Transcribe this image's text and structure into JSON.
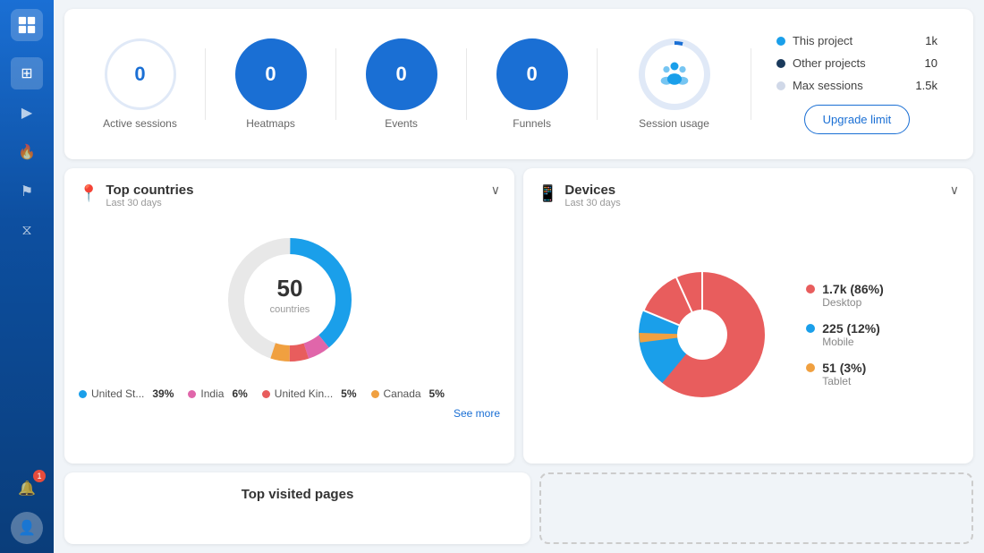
{
  "sidebar": {
    "icons": [
      {
        "name": "grid-icon",
        "symbol": "⊞",
        "active": true
      },
      {
        "name": "play-icon",
        "symbol": "▶"
      },
      {
        "name": "flame-icon",
        "symbol": "🔥"
      },
      {
        "name": "flag-icon",
        "symbol": "⚑"
      },
      {
        "name": "filter-icon",
        "symbol": "⧖"
      }
    ],
    "bottom_icons": [
      {
        "name": "bell-icon",
        "symbol": "🔔",
        "badge": "1"
      },
      {
        "name": "avatar-icon",
        "symbol": "👤"
      }
    ]
  },
  "stats": {
    "items": [
      {
        "label": "Active sessions",
        "value": "0",
        "filled": false
      },
      {
        "label": "Heatmaps",
        "value": "0",
        "filled": true
      },
      {
        "label": "Events",
        "value": "0",
        "filled": true
      },
      {
        "label": "Funnels",
        "value": "0",
        "filled": true
      }
    ],
    "session_usage": {
      "label": "Session usage"
    }
  },
  "legend": {
    "items": [
      {
        "label": "This project",
        "value": "1k",
        "color": "#1a9fea"
      },
      {
        "label": "Other projects",
        "value": "10",
        "color": "#1a3a5c"
      },
      {
        "label": "Max sessions",
        "value": "1.5k",
        "color": "#d0d8e8"
      }
    ],
    "upgrade_button": "Upgrade limit"
  },
  "top_countries": {
    "title": "Top countries",
    "subtitle": "Last 30 days",
    "center_number": "50",
    "center_label": "countries",
    "countries": [
      {
        "name": "United St...",
        "pct": "39%",
        "color": "#1a9fea"
      },
      {
        "name": "India",
        "pct": "6%",
        "color": "#e066aa"
      },
      {
        "name": "United Kin...",
        "pct": "5%",
        "color": "#e85d5d"
      },
      {
        "name": "Canada",
        "pct": "5%",
        "color": "#f0a040"
      }
    ],
    "see_more": "See more"
  },
  "devices": {
    "title": "Devices",
    "subtitle": "Last 30 days",
    "items": [
      {
        "label": "Desktop",
        "count": "1.7k (86%)",
        "color": "#e85d5d"
      },
      {
        "label": "Mobile",
        "count": "225 (12%)",
        "color": "#1a9fea"
      },
      {
        "label": "Tablet",
        "count": "51 (3%)",
        "color": "#f0a040"
      }
    ]
  },
  "top_pages": {
    "title": "Top visited pages"
  },
  "colors": {
    "accent": "#1a6fd4",
    "sidebar_top": "#1a6fd4",
    "sidebar_bottom": "#0a3d7a"
  }
}
